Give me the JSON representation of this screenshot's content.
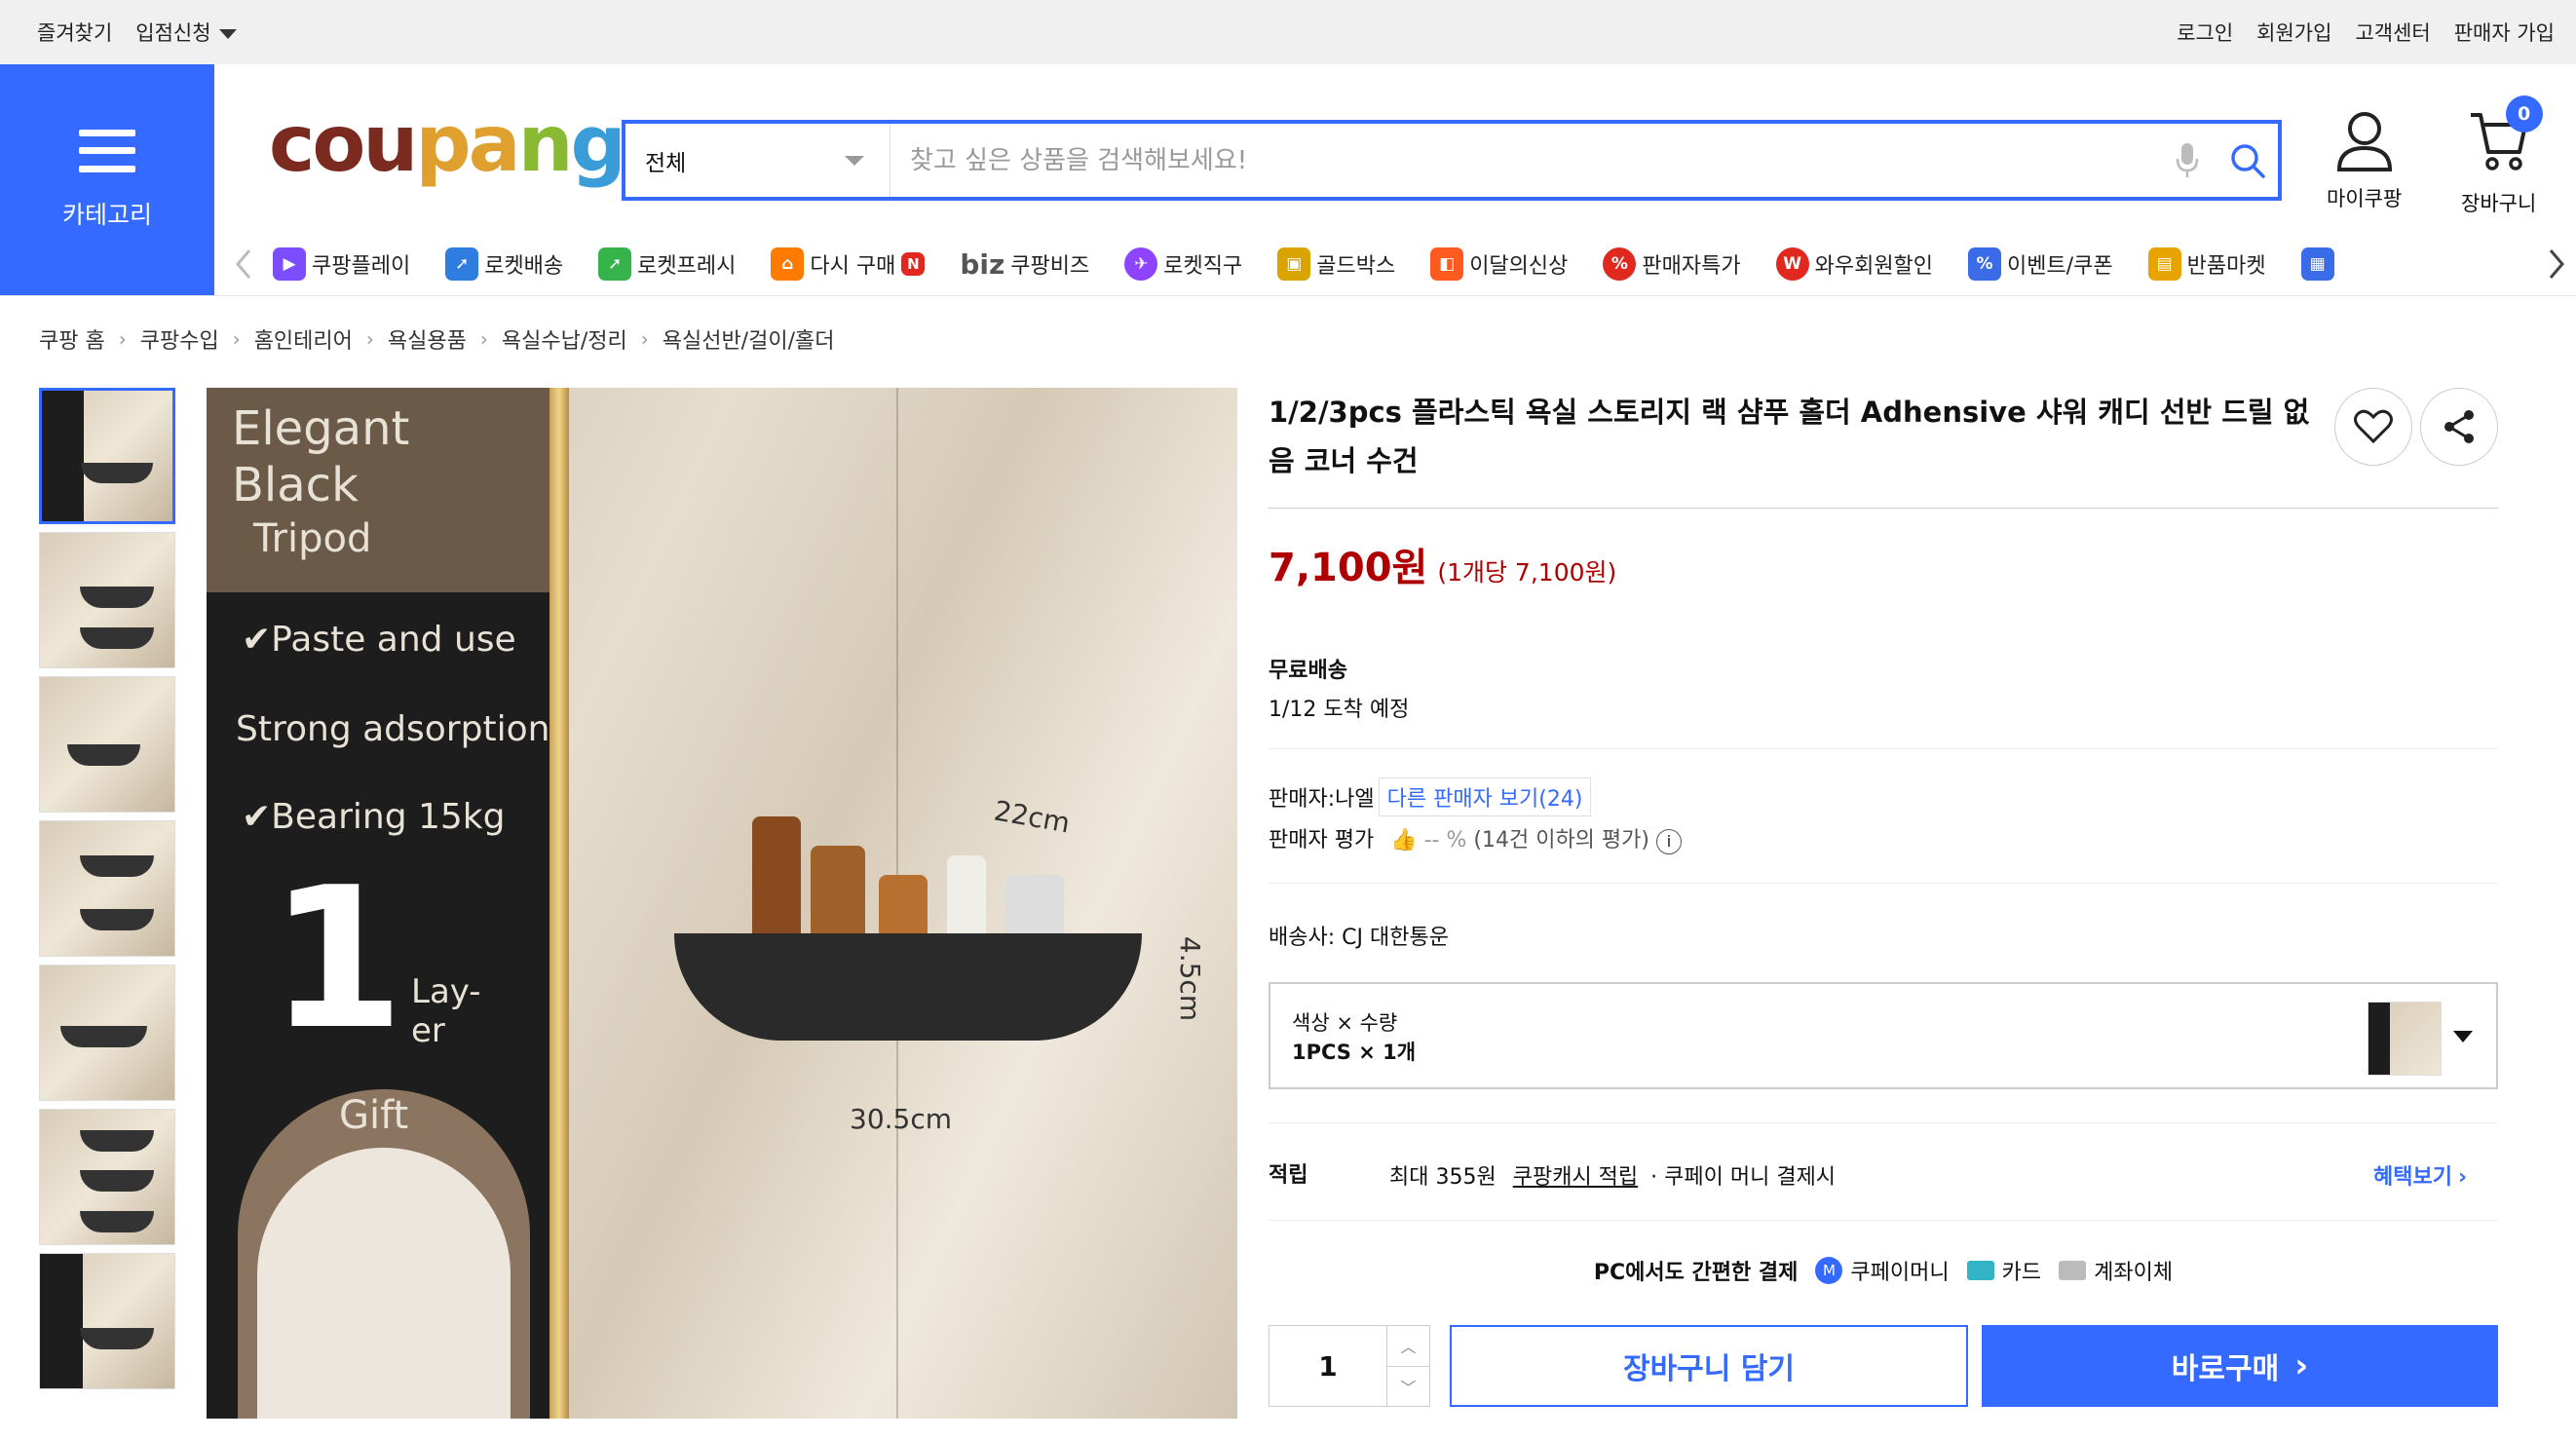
{
  "topbar": {
    "left": [
      "즐겨찾기",
      "입점신청"
    ],
    "right": [
      "로그인",
      "회원가입",
      "고객센터",
      "판매자 가입"
    ]
  },
  "category": {
    "label": "카테고리"
  },
  "logo": {
    "text_parts": [
      "cou",
      "pa",
      "n",
      "g"
    ]
  },
  "search": {
    "category_selected": "전체",
    "placeholder": "찾고 싶은 상품을 검색해보세요!"
  },
  "header_icons": {
    "mycoupang": "마이쿠팡",
    "cart": "장바구니",
    "cart_count": "0"
  },
  "services": [
    {
      "label": "쿠팡플레이",
      "color": "#7b4dff"
    },
    {
      "label": "로켓배송",
      "color": "#2f7de1"
    },
    {
      "label": "로켓프레시",
      "color": "#36b34a"
    },
    {
      "label": "다시 구매",
      "color": "#ff7a00",
      "badge": "N"
    },
    {
      "label": "쿠팡비즈",
      "prefix": "biz",
      "color": "#555"
    },
    {
      "label": "로켓직구",
      "color": "#8e44ff"
    },
    {
      "label": "골드박스",
      "color": "#d9a300"
    },
    {
      "label": "이달의신상",
      "color": "#ff5a1f"
    },
    {
      "label": "판매자특가",
      "color": "#e0281e"
    },
    {
      "label": "와우회원할인",
      "color": "#e0281e"
    },
    {
      "label": "이벤트/쿠폰",
      "color": "#3a6be8"
    },
    {
      "label": "반품마켓",
      "color": "#e7a400"
    }
  ],
  "breadcrumb": [
    "쿠팡 홈",
    "쿠팡수입",
    "홈인테리어",
    "욕실용품",
    "욕실수납/정리",
    "욕실선반/걸이/홀더"
  ],
  "main_image": {
    "heading": [
      "Elegant",
      "Black",
      "Tripod"
    ],
    "features": [
      "Paste and use",
      "Strong adsorption",
      "Bearing 15kg"
    ],
    "layer_number": "1",
    "layer_text": [
      "Lay-",
      "er"
    ],
    "gift": "Gift",
    "dims": [
      "22cm",
      "4.5cm",
      "30.5cm"
    ]
  },
  "product": {
    "title": "1/2/3pcs 플라스틱 욕실 스토리지 랙 샴푸 홀더 Adhensive 샤워 캐디 선반 드릴 없음 코너 수건",
    "price": "7,100원",
    "unit_price": "(1개당 7,100원)",
    "shipping_label": "무료배송",
    "arrival": "1/12 도착 예정",
    "seller_label": "판매자:나엘",
    "other_sellers": "다른 판매자 보기(24)",
    "seller_rating_label": "판매자 평가",
    "seller_rating_value": "-- %",
    "seller_rating_note": "(14건 이하의 평가)",
    "carrier": "배송사:  CJ 대한통운",
    "option_label": "색상 × 수량",
    "option_value": "1PCS × 1개",
    "reward_label": "적립",
    "reward_text": "최대 355원",
    "reward_link": "쿠팡캐시 적립",
    "reward_tail": "· 쿠페이 머니 결제시",
    "benefit_link": "혜택보기",
    "pay_title": "PC에서도 간편한 결제",
    "pay_methods": [
      "쿠페이머니",
      "카드",
      "계좌이체"
    ],
    "quantity": "1",
    "cart_button": "장바구니 담기",
    "buy_button": "바로구매"
  }
}
